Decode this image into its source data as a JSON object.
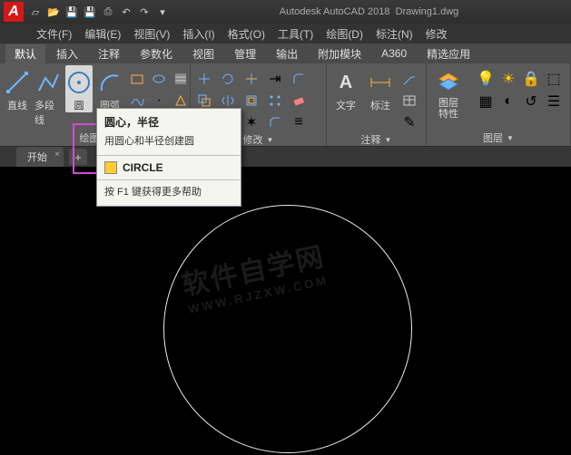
{
  "title": {
    "app": "Autodesk AutoCAD 2018",
    "doc": "Drawing1.dwg"
  },
  "logo": "A",
  "menus": [
    "文件(F)",
    "编辑(E)",
    "视图(V)",
    "插入(I)",
    "格式(O)",
    "工具(T)",
    "绘图(D)",
    "标注(N)",
    "修改"
  ],
  "ribbon_tabs": [
    "默认",
    "插入",
    "注释",
    "参数化",
    "视图",
    "管理",
    "输出",
    "附加模块",
    "A360",
    "精选应用"
  ],
  "panels": {
    "draw": {
      "label": "绘图",
      "btns": {
        "line": "直线",
        "polyline": "多段线",
        "circle": "圆",
        "arc": "圆弧"
      }
    },
    "modify": {
      "label": "修改"
    },
    "annot": {
      "label": "注释",
      "btns": {
        "text": "文字",
        "dim": "标注"
      }
    },
    "layer": {
      "label": "图层",
      "btn": "图层\n特性"
    }
  },
  "tooltip": {
    "title": "圆心，半径",
    "desc": "用圆心和半径创建圆",
    "cmd": "CIRCLE",
    "help": "按 F1 键获得更多帮助"
  },
  "doctab": "开始",
  "watermark": {
    "main": "软件自学网",
    "sub": "WWW.RJZXW.COM"
  }
}
